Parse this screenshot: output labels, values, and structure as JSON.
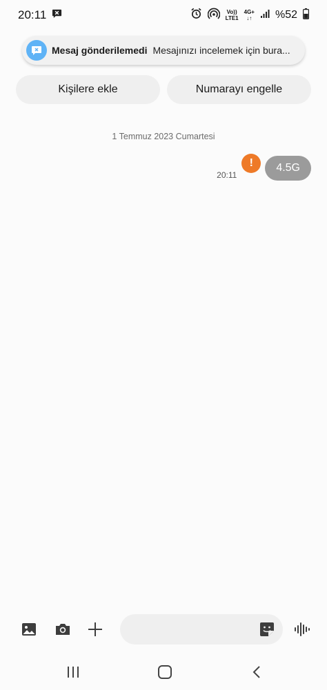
{
  "status_bar": {
    "time": "20:11",
    "volte_line1": "Vo))",
    "volte_line2": "LTE1",
    "network_line1": "4G+",
    "network_line2": "↓↑",
    "battery_text": "%52",
    "icons": [
      "message-blocked-icon",
      "alarm-icon",
      "hotspot-icon",
      "signal-icon",
      "battery-icon"
    ]
  },
  "notification": {
    "title": "Mesaj gönderilemedi",
    "body": "Mesajınızı incelemek için bura...",
    "icon": "message-error-icon",
    "accent": "#5fb3f6"
  },
  "actions": {
    "add_contact": "Kişilere ekle",
    "block_number": "Numarayı engelle"
  },
  "conversation": {
    "date": "1 Temmuz 2023 Cumartesi",
    "messages": [
      {
        "time": "20:11",
        "text": "4.5G",
        "status": "failed",
        "status_glyph": "!",
        "status_color": "#ee7a28",
        "bubble_color": "#9b9b9b"
      }
    ]
  },
  "composer": {
    "input_value": "",
    "input_placeholder": "",
    "icons": [
      "gallery-icon",
      "camera-icon",
      "plus-icon",
      "sticker-icon",
      "voice-icon"
    ]
  },
  "nav_bar": {
    "icons": [
      "recents-icon",
      "home-icon",
      "back-icon"
    ]
  }
}
